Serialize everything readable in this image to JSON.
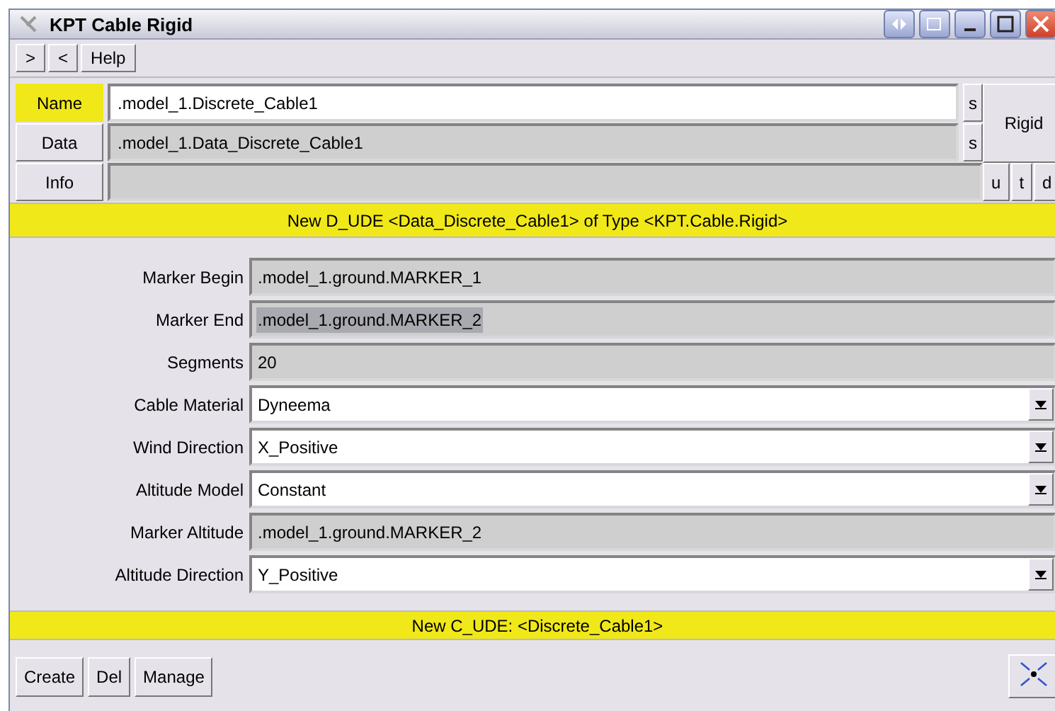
{
  "window": {
    "title": "KPT Cable Rigid"
  },
  "toolbar": [
    ">",
    "<",
    "Help"
  ],
  "header_rows": [
    {
      "label": "Name",
      "highlighted": true,
      "value": ".model_1.Discrete_Cable1",
      "editable": true,
      "side_button": "s"
    },
    {
      "label": "Data",
      "highlighted": false,
      "value": ".model_1.Data_Discrete_Cable1",
      "editable": false,
      "side_button": "s"
    }
  ],
  "info": {
    "label": "Info",
    "buttons": [
      "u",
      "t",
      "d"
    ]
  },
  "type_button": "Rigid",
  "banner_top": "New D_UDE <Data_Discrete_Cable1> of Type <KPT.Cable.Rigid>",
  "fields": [
    {
      "label": "Marker Begin",
      "kind": "text",
      "value": ".model_1.ground.MARKER_1",
      "highlighted": false
    },
    {
      "label": "Marker End",
      "kind": "text",
      "value": ".model_1.ground.MARKER_2",
      "highlighted": true
    },
    {
      "label": "Segments",
      "kind": "text",
      "value": "20",
      "highlighted": false
    },
    {
      "label": "Cable Material",
      "kind": "dropdown",
      "value": "Dyneema",
      "highlighted": false
    },
    {
      "label": "Wind Direction",
      "kind": "dropdown",
      "value": "X_Positive",
      "highlighted": false
    },
    {
      "label": "Altitude Model",
      "kind": "dropdown",
      "value": "Constant",
      "highlighted": false
    },
    {
      "label": "Marker Altitude",
      "kind": "text",
      "value": ".model_1.ground.MARKER_2",
      "highlighted": false
    },
    {
      "label": "Altitude Direction",
      "kind": "dropdown",
      "value": "Y_Positive",
      "highlighted": false
    }
  ],
  "banner_bottom": "New C_UDE: <Discrete_Cable1>",
  "footer_buttons": [
    "Create",
    "Del",
    "Manage"
  ]
}
